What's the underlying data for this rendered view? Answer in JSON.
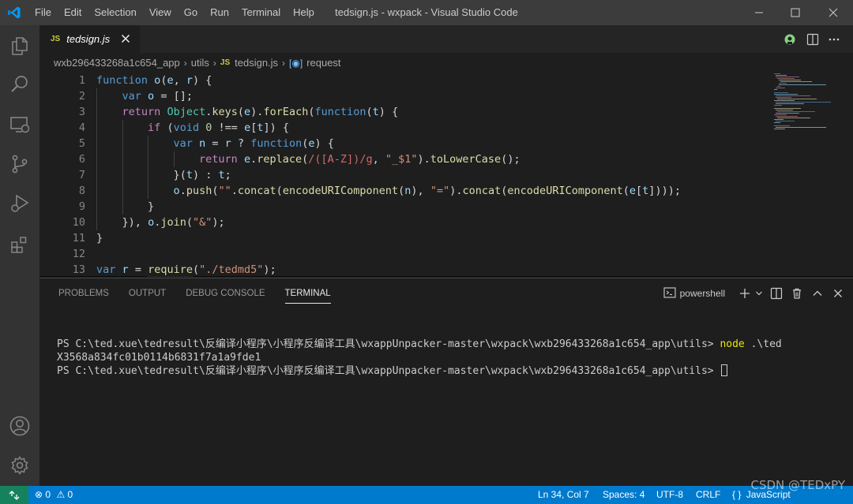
{
  "window": {
    "title": "tedsign.js - wxpack - Visual Studio Code",
    "menu": [
      "File",
      "Edit",
      "Selection",
      "View",
      "Go",
      "Run",
      "Terminal",
      "Help"
    ]
  },
  "activity_bar": [
    "explorer-icon",
    "search-icon",
    "remote-explorer-icon",
    "source-control-icon",
    "run-debug-icon",
    "extensions-icon",
    "accounts-icon",
    "manage-gear-icon"
  ],
  "tab": {
    "badge": "JS",
    "name": "tedsign.js"
  },
  "breadcrumbs": {
    "folder1": "wxb296433268a1c654_app",
    "folder2": "utils",
    "file_badge": "JS",
    "file": "tedsign.js",
    "symbol": "request"
  },
  "editor": {
    "line_numbers": [
      "1",
      "2",
      "3",
      "4",
      "5",
      "6",
      "7",
      "8",
      "9",
      "10",
      "11",
      "12",
      "13"
    ],
    "lines": [
      "function o(e, r) {",
      "    var o = [];",
      "    return Object.keys(e).forEach(function(t) {",
      "        if (void 0 !== e[t]) {",
      "            var n = r ? function(e) {",
      "                return e.replace(/([A-Z])/g, \"_$1\").toLowerCase();",
      "            }(t) : t;",
      "            o.push(\"\".concat(encodeURIComponent(n), \"=\").concat(encodeURIComponent(e[t])));",
      "        }",
      "    }), o.join(\"&\");",
      "}",
      "",
      "var r = require(\"./tedmd5\");"
    ]
  },
  "panel": {
    "tabs": [
      "PROBLEMS",
      "OUTPUT",
      "DEBUG CONSOLE",
      "TERMINAL"
    ],
    "active_tab": "TERMINAL",
    "shell": "powershell"
  },
  "terminal": {
    "prompt1": "PS C:\\ted.xue\\tedresult\\反编译小程序\\小程序反编译工具\\wxappUnpacker-master\\wxpack\\wxb296433268a1c654_app\\utils> ",
    "cmd": "node",
    "cmd_arg": " .\\ted",
    "output": "X3568a834fc01b0114b6831f7a1a9fde1",
    "prompt2": "PS C:\\ted.xue\\tedresult\\反编译小程序\\小程序反编译工具\\wxappUnpacker-master\\wxpack\\wxb296433268a1c654_app\\utils> "
  },
  "status_bar": {
    "errors": "0",
    "warnings": "0",
    "position": "Ln 34, Col 7",
    "spaces": "Spaces: 4",
    "encoding": "UTF-8",
    "eol": "CRLF",
    "language_prefix": "{ }",
    "language": "JavaScript"
  },
  "watermark": "CSDN @TEDxPY",
  "colors": {
    "statusbar": "#007acc",
    "remote": "#16825d",
    "titlebar": "#3c3c3c",
    "editor_bg": "#1e1e1e"
  }
}
